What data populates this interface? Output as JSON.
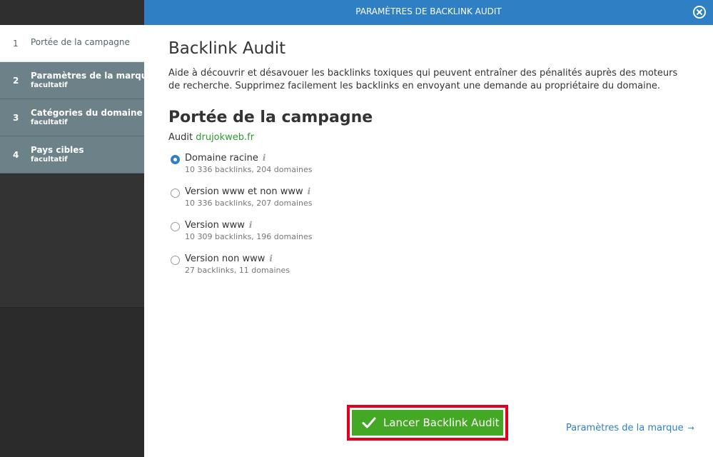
{
  "header": {
    "title": "PARAMÈTRES DE BACKLINK AUDIT"
  },
  "sidebar": {
    "steps": [
      {
        "num": "1",
        "label": "Portée de la campagne",
        "sub": ""
      },
      {
        "num": "2",
        "label": "Paramètres de la marque",
        "sub": "facultatif"
      },
      {
        "num": "3",
        "label": "Catégories du domaine",
        "sub": "facultatif"
      },
      {
        "num": "4",
        "label": "Pays cibles",
        "sub": "facultatif"
      }
    ]
  },
  "main": {
    "title": "Backlink Audit",
    "description": "Aide à découvrir et désavouer les backlinks toxiques qui peuvent entraîner des pénalités auprès des moteurs de recherche. Supprimez facilement les backlinks en envoyant une demande au propriétaire du domaine.",
    "subtitle": "Portée de la campagne",
    "audit_prefix": "Audit",
    "audit_domain": "drujokweb.fr",
    "options": [
      {
        "label": "Domaine racine",
        "meta": "10 336 backlinks, 204 domaines",
        "selected": true
      },
      {
        "label": "Version www et non www",
        "meta": "10 336 backlinks, 207 domaines",
        "selected": false
      },
      {
        "label": "Version www",
        "meta": "10 309 backlinks, 196 domaines",
        "selected": false
      },
      {
        "label": "Version non www",
        "meta": "27 backlinks, 11 domaines",
        "selected": false
      }
    ]
  },
  "footer": {
    "launch_label": "Lancer Backlink Audit",
    "next_label": "Paramètres de la marque",
    "next_icon": "→"
  },
  "colors": {
    "accent": "#2f7fc4",
    "launch": "#43a823",
    "highlight_border": "#e0001b",
    "sidebar_step": "#6d8189"
  }
}
